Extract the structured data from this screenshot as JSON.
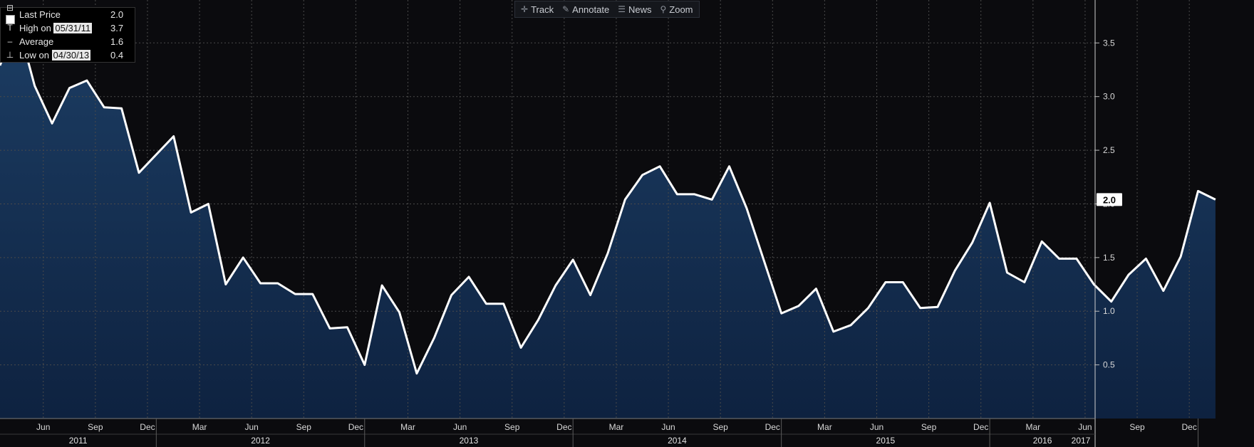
{
  "toolbar": {
    "track_label": "Track",
    "annotate_label": "Annotate",
    "news_label": "News",
    "zoom_label": "Zoom"
  },
  "legend": {
    "last_label": "Last Price",
    "last_value": "2.0",
    "high_prefix": "High on ",
    "high_date": "05/31/11",
    "high_value": "3.7",
    "avg_label": "Average",
    "avg_value": "1.6",
    "low_prefix": "Low on ",
    "low_date": "04/30/13",
    "low_value": "0.4"
  },
  "last_tag": "2.0",
  "colors": {
    "background": "#0b0b0e",
    "area_top": "#1c3d63",
    "area_bottom": "#0e2240",
    "line": "#ffffff",
    "grid": "#4a4a4a"
  },
  "chart_data": {
    "type": "area",
    "x": [
      "2011-04",
      "2011-05",
      "2011-06",
      "2011-07",
      "2011-08",
      "2011-09",
      "2011-10",
      "2011-11",
      "2011-12",
      "2012-01",
      "2012-02",
      "2012-03",
      "2012-04",
      "2012-05",
      "2012-06",
      "2012-07",
      "2012-08",
      "2012-09",
      "2012-10",
      "2012-11",
      "2012-12",
      "2013-01",
      "2013-02",
      "2013-03",
      "2013-04",
      "2013-05",
      "2013-06",
      "2013-07",
      "2013-08",
      "2013-09",
      "2013-10",
      "2013-11",
      "2013-12",
      "2014-01",
      "2014-02",
      "2014-03",
      "2014-04",
      "2014-05",
      "2014-06",
      "2014-07",
      "2014-08",
      "2014-09",
      "2014-10",
      "2014-11",
      "2014-12",
      "2015-01",
      "2015-02",
      "2015-03",
      "2015-04",
      "2015-05",
      "2015-06",
      "2015-07",
      "2015-08",
      "2015-09",
      "2015-10",
      "2015-11",
      "2015-12",
      "2016-01",
      "2016-02",
      "2016-03",
      "2016-04",
      "2016-05",
      "2016-06",
      "2016-07",
      "2016-08",
      "2016-09",
      "2016-10",
      "2016-11",
      "2016-12",
      "2017-01",
      "2017-02"
    ],
    "values": [
      3.29,
      3.7,
      3.1,
      2.75,
      3.08,
      3.15,
      2.9,
      2.89,
      2.29,
      2.46,
      2.63,
      1.92,
      2.0,
      1.25,
      1.5,
      1.26,
      1.26,
      1.16,
      1.16,
      0.84,
      0.85,
      0.5,
      1.24,
      0.99,
      0.42,
      0.75,
      1.15,
      1.32,
      1.07,
      1.07,
      0.66,
      0.92,
      1.24,
      1.48,
      1.15,
      1.54,
      2.04,
      2.27,
      2.35,
      2.09,
      2.09,
      2.04,
      2.35,
      1.96,
      1.47,
      0.98,
      1.05,
      1.21,
      0.81,
      0.87,
      1.03,
      1.27,
      1.27,
      1.03,
      1.04,
      1.38,
      1.64,
      2.01,
      1.36,
      1.27,
      1.65,
      1.49,
      1.49,
      1.25,
      1.09,
      1.34,
      1.49,
      1.19,
      1.51,
      2.12,
      2.04
    ],
    "month_ticks": [
      "Jun",
      "Sep",
      "Dec",
      "Mar",
      "Jun",
      "Sep",
      "Dec",
      "Mar",
      "Jun",
      "Sep",
      "Dec",
      "Mar",
      "Jun",
      "Sep",
      "Dec",
      "Mar",
      "Jun",
      "Sep",
      "Dec",
      "Mar",
      "Jun",
      "Sep",
      "Dec"
    ],
    "years": [
      "2011",
      "2012",
      "2013",
      "2014",
      "2015",
      "2016",
      "2017"
    ],
    "y_ticks": [
      "0.5",
      "1.0",
      "1.5",
      "2.0",
      "2.5",
      "3.0",
      "3.5"
    ],
    "ylim": [
      0.0,
      3.9
    ],
    "grid": true,
    "axis_side": "right"
  }
}
